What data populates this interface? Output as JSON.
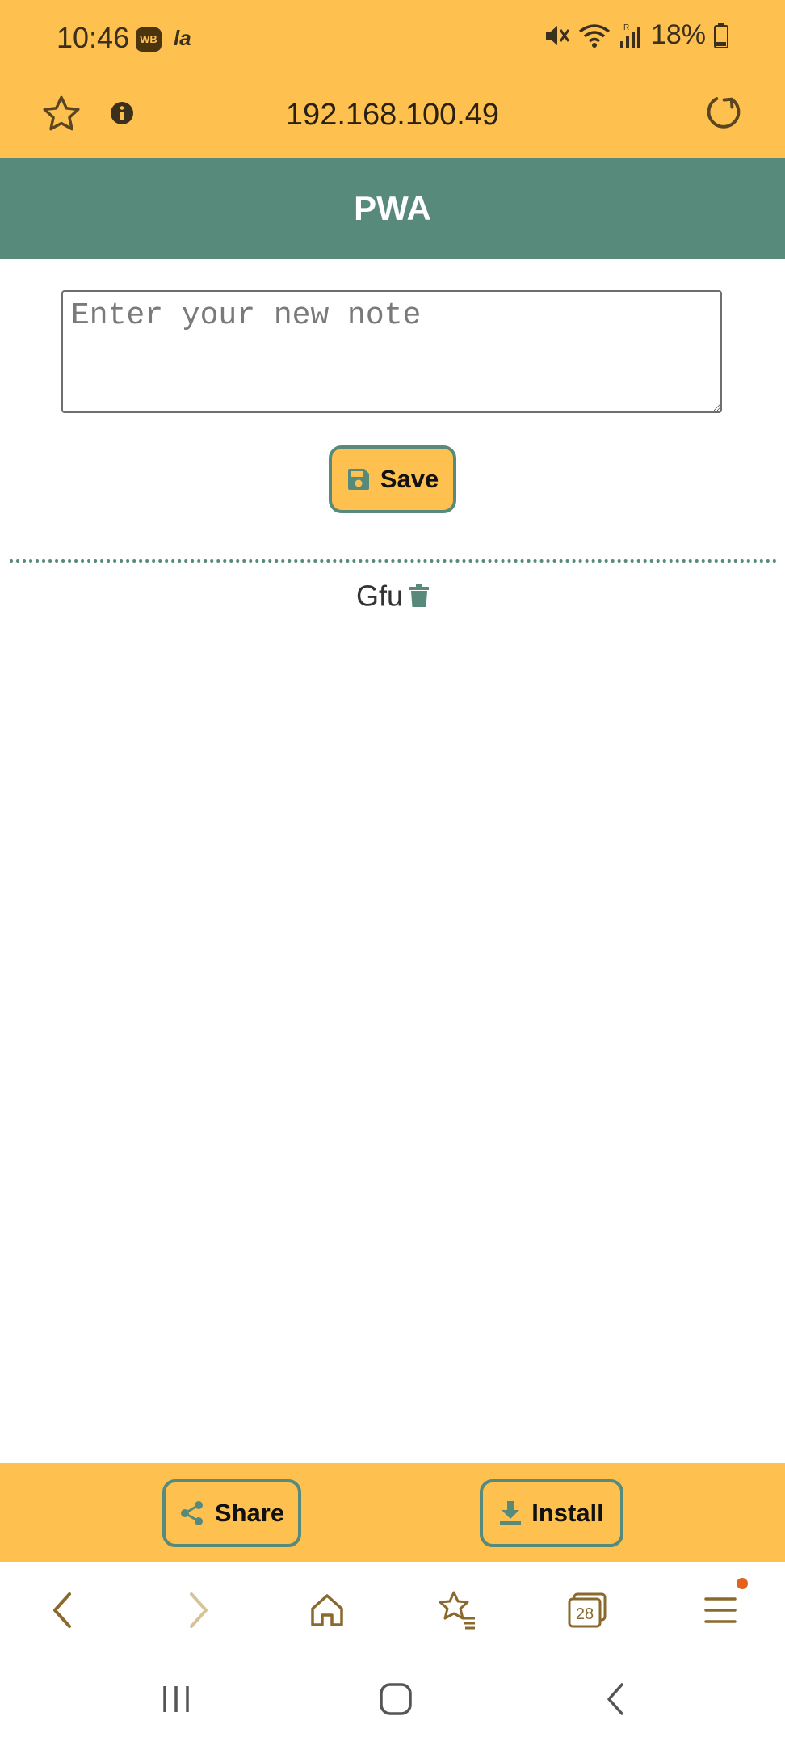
{
  "status_bar": {
    "time": "10:46",
    "badge_wb": "WB",
    "badge_la": "la",
    "battery": "18%",
    "icons": [
      "mute-icon",
      "wifi-icon",
      "signal-icon",
      "battery-icon"
    ]
  },
  "url_bar": {
    "url": "192.168.100.49",
    "icons": [
      "star-icon",
      "info-icon",
      "reload-icon"
    ]
  },
  "app": {
    "title": "PWA",
    "note_input": {
      "placeholder": "Enter your new note",
      "value": ""
    },
    "save_label": "Save",
    "notes": [
      "Gfu"
    ]
  },
  "bottom_bar": {
    "share_label": "Share",
    "install_label": "Install"
  },
  "browser_nav": {
    "tab_count": "28",
    "icons": [
      "back-icon",
      "forward-icon",
      "home-icon",
      "bookmarks-icon",
      "tabs-icon",
      "menu-icon"
    ]
  },
  "colors": {
    "accent": "#FEC150",
    "primary": "#578A7B",
    "notification_dot": "#E3621C"
  }
}
